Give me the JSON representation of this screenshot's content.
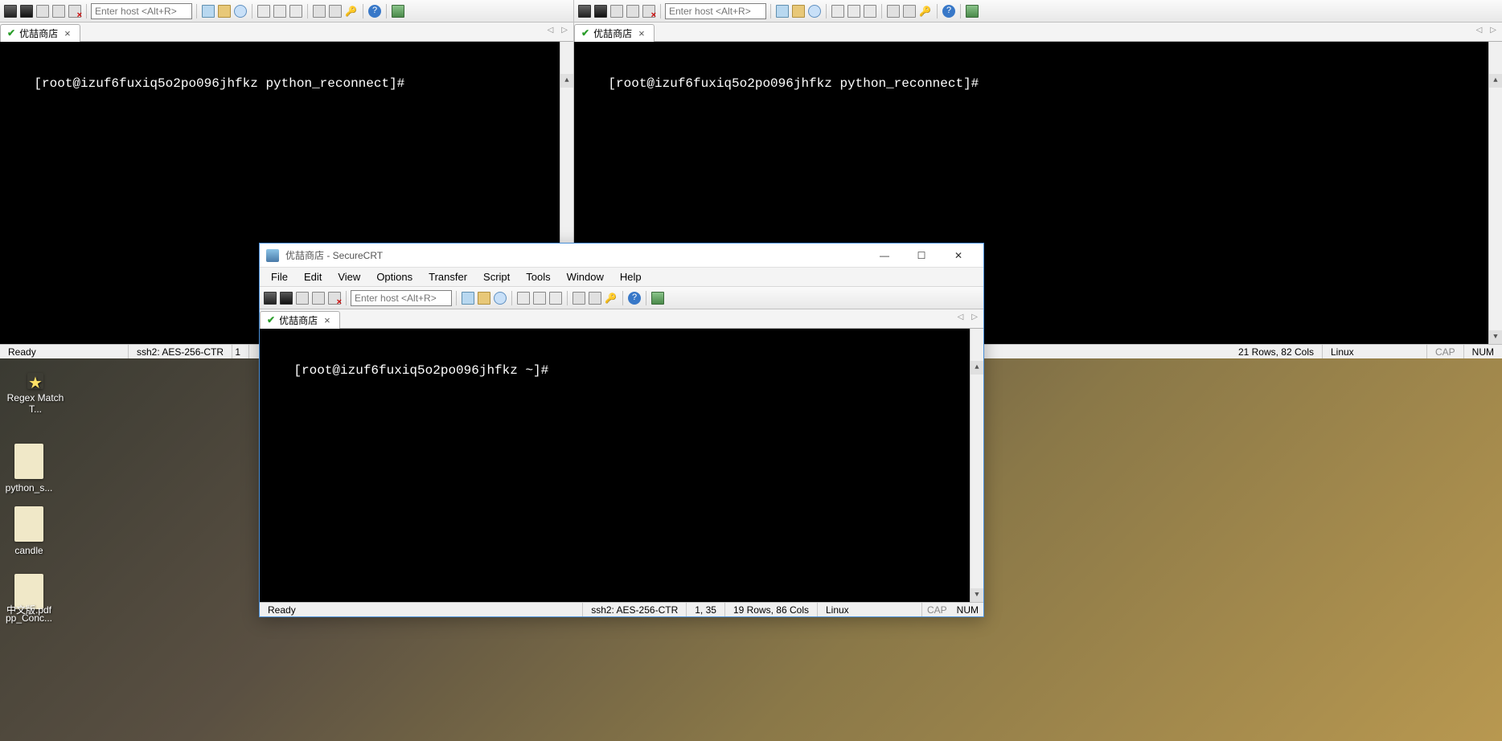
{
  "host_placeholder": "Enter host <Alt+R>",
  "bg_left": {
    "tab_label": "优喆商店",
    "prompt": "[root@izuf6fuxiq5o2po096jhfkz python_reconnect]#"
  },
  "bg_right": {
    "tab_label": "优喆商店",
    "prompt": "[root@izuf6fuxiq5o2po096jhfkz python_reconnect]#"
  },
  "fullstatus": {
    "ready": "Ready",
    "ssh": "ssh2: AES-256-CTR",
    "cursor": "1",
    "dims": "21 Rows, 82 Cols",
    "os": "Linux",
    "cap": "CAP",
    "num": "NUM"
  },
  "fg": {
    "title": "优喆商店 - SecureCRT",
    "menu": {
      "file": "File",
      "edit": "Edit",
      "view": "View",
      "options": "Options",
      "transfer": "Transfer",
      "script": "Script",
      "tools": "Tools",
      "window": "Window",
      "help": "Help"
    },
    "tab_label": "优喆商店",
    "prompt": "[root@izuf6fuxiq5o2po096jhfkz ~]#",
    "status": {
      "ready": "Ready",
      "ssh": "ssh2: AES-256-CTR",
      "cursor": "1,  35",
      "dims": "19 Rows, 86 Cols",
      "os": "Linux",
      "cap": "CAP",
      "num": "NUM"
    }
  },
  "desktop": {
    "icon1": "Regex Match T...",
    "icon2": "python_s...",
    "icon3": "candle",
    "icon4": "pp_Conc...",
    "icon5": "中文版.pdf"
  }
}
